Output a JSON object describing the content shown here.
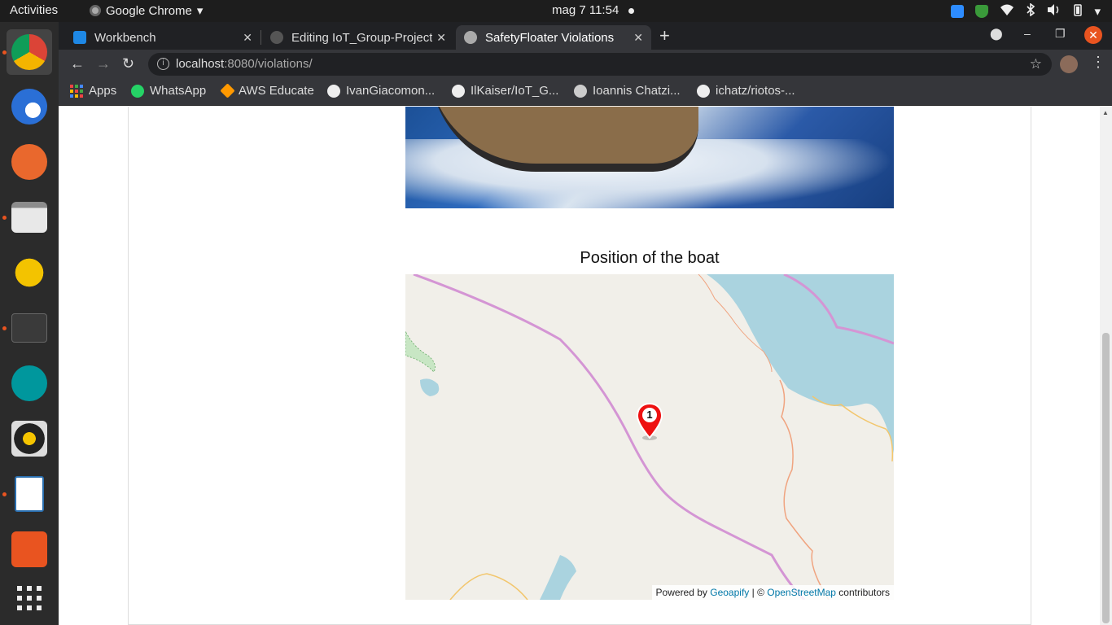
{
  "system_bar": {
    "activities": "Activities",
    "app_name": "Google Chrome",
    "clock": "mag 7  11:54"
  },
  "browser": {
    "tabs": [
      {
        "label": "Workbench",
        "active": false
      },
      {
        "label": "Editing IoT_Group-Project",
        "active": false
      },
      {
        "label": "SafetyFloater Violations",
        "active": true
      }
    ],
    "url_host": "localhost",
    "url_rest": ":8080/violations/",
    "bookmarks": [
      {
        "label": "Apps",
        "icon": "apps-grid-icon"
      },
      {
        "label": "WhatsApp",
        "icon": "whatsapp-icon"
      },
      {
        "label": "AWS Educate",
        "icon": "aws-icon"
      },
      {
        "label": "IvanGiacomon...",
        "icon": "github-icon"
      },
      {
        "label": "IlKaiser/IoT_G...",
        "icon": "github-icon"
      },
      {
        "label": "Ioannis Chatzi...",
        "icon": "globe-icon"
      },
      {
        "label": "ichatz/riotos-...",
        "icon": "github-icon"
      }
    ]
  },
  "page": {
    "map_heading": "Position of the boat",
    "marker_label": "1",
    "attribution_prefix": "Powered by ",
    "attribution_link1": "Geoapify",
    "attribution_sep": " | © ",
    "attribution_link2": "OpenStreetMap",
    "attribution_suffix": " contributors"
  },
  "colors": {
    "marker": "#e11",
    "water": "#aad3df",
    "boundary": "#d495d4",
    "road": "#f0a480"
  }
}
